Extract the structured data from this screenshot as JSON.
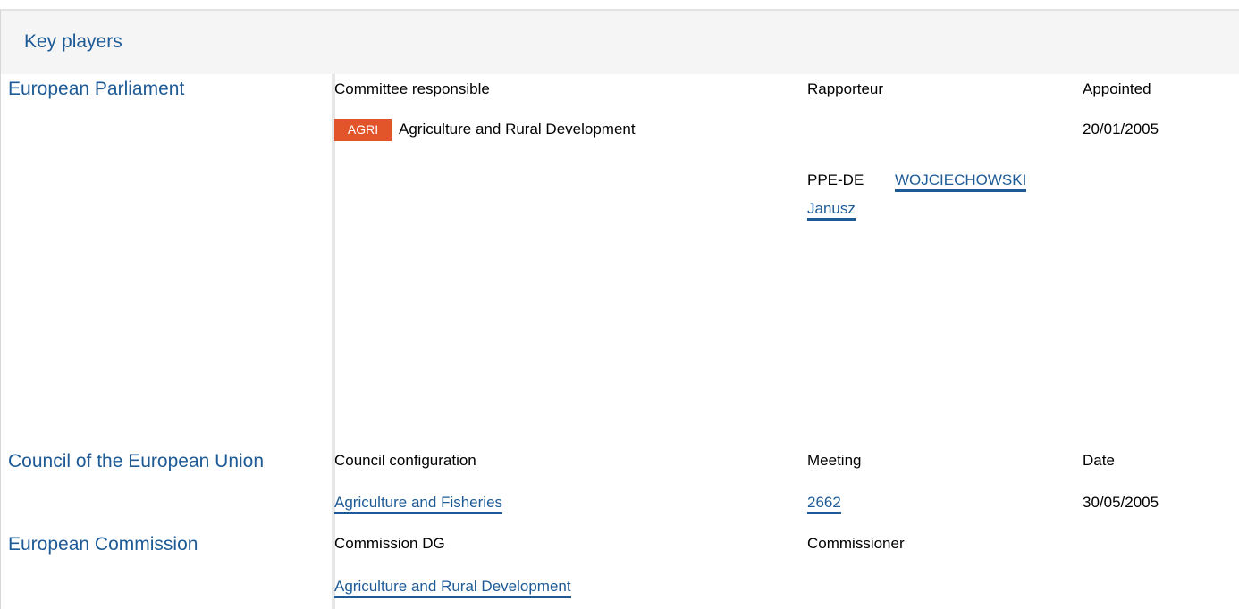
{
  "header": {
    "title": "Key players"
  },
  "parliament": {
    "label": "European Parliament",
    "committee_header": "Committee responsible",
    "rapporteur_header": "Rapporteur",
    "appointed_header": "Appointed",
    "committee_badge": "AGRI",
    "committee_badge_color": "#e2552b",
    "committee_name": "Agriculture and Rural Development",
    "appointed_date": "20/01/2005",
    "rapporteur_group": "PPE-DE",
    "rapporteur_name_line1": "WOJCIECHOWSKI",
    "rapporteur_name_line2": "Janusz"
  },
  "council": {
    "label": "Council of the European Union",
    "config_header": "Council configuration",
    "meeting_header": "Meeting",
    "date_header": "Date",
    "config_value": "Agriculture and Fisheries",
    "meeting_value": "2662",
    "date_value": "30/05/2005"
  },
  "commission": {
    "label": "European Commission",
    "dg_header": "Commission DG",
    "commissioner_header": "Commissioner",
    "dg_value": "Agriculture and Rural Development"
  },
  "colors": {
    "link": "#1d5a96",
    "header_bg": "#f5f5f5"
  }
}
